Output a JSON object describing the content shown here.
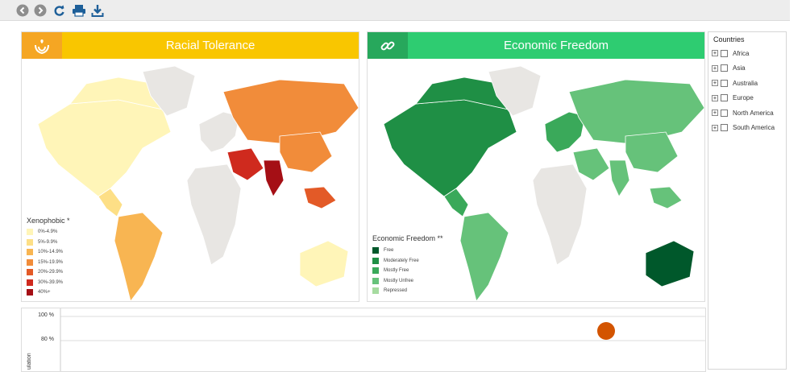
{
  "toolbar": {
    "icons": [
      "back-icon",
      "forward-icon",
      "refresh-icon",
      "print-icon",
      "download-icon"
    ]
  },
  "panels": {
    "racial": {
      "title": "Racial Tolerance",
      "icon": "hands-icon",
      "head_color": "#f9c600",
      "icon_color": "#f5a623",
      "legend_title": "Xenophobic *",
      "legend": [
        {
          "label": "0%-4.9%",
          "color": "#fff5b8"
        },
        {
          "label": "5%-9.9%",
          "color": "#fddf86"
        },
        {
          "label": "10%-14.9%",
          "color": "#f8b552"
        },
        {
          "label": "15%-19.9%",
          "color": "#f18c3a"
        },
        {
          "label": "20%-29.9%",
          "color": "#e35a27"
        },
        {
          "label": "30%-39.9%",
          "color": "#cf2a1e"
        },
        {
          "label": "40%+",
          "color": "#a50f15"
        }
      ]
    },
    "economic": {
      "title": "Economic Freedom",
      "icon": "link-icon",
      "head_color": "#2ecc71",
      "icon_color": "#27a85c",
      "legend_title": "Economic Freedom **",
      "legend": [
        {
          "label": "Free",
          "color": "#00582b"
        },
        {
          "label": "Moderately Free",
          "color": "#1f8f45"
        },
        {
          "label": "Mostly Free",
          "color": "#3aa95a"
        },
        {
          "label": "Mostly Unfree",
          "color": "#66c27a"
        },
        {
          "label": "Repressed",
          "color": "#a6dba0"
        }
      ]
    }
  },
  "countries": {
    "title": "Countries",
    "items": [
      "Africa",
      "Asia",
      "Australia",
      "Europe",
      "North America",
      "South America"
    ]
  },
  "scatter": {
    "y_ticks": [
      "100 %",
      "80 %"
    ],
    "ylabel_fragment": "ulation",
    "point_color": "#d35400"
  }
}
